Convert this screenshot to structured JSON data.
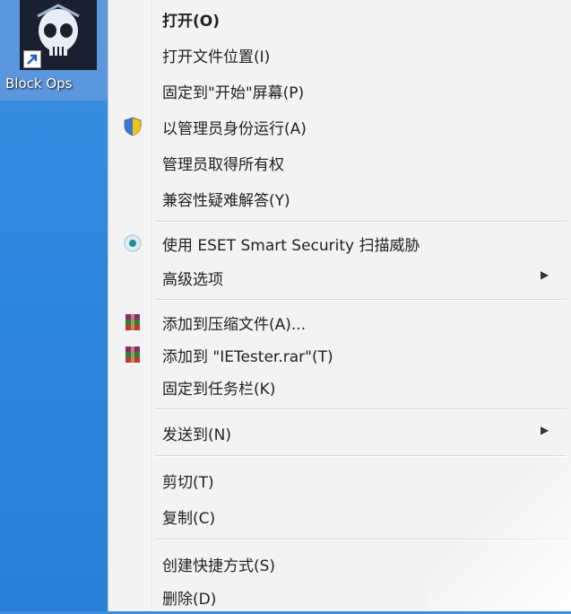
{
  "desktop": {
    "icon_label": "Block Ops"
  },
  "menu": {
    "open": "打开(O)",
    "open_location": "打开文件位置(I)",
    "pin_start": "固定到\"开始\"屏幕(P)",
    "run_admin": "以管理员身份运行(A)",
    "take_ownership": "管理员取得所有权",
    "compat": "兼容性疑难解答(Y)",
    "eset_scan": "使用 ESET Smart Security 扫描威胁",
    "advanced": "高级选项",
    "add_archive": "添加到压缩文件(A)...",
    "add_rar": "添加到 \"IETester.rar\"(T)",
    "pin_taskbar": "固定到任务栏(K)",
    "send_to": "发送到(N)",
    "cut": "剪切(T)",
    "copy": "复制(C)",
    "create_shortcut": "创建快捷方式(S)",
    "delete": "删除(D)"
  },
  "colors": {
    "desktop": "#2f86de",
    "menu_bg": "#f3f3f3",
    "separator": "#d6d6d6"
  },
  "icons": {
    "shield": "uac-shield-icon",
    "eset": "eset-icon",
    "winrar": "winrar-icon"
  }
}
